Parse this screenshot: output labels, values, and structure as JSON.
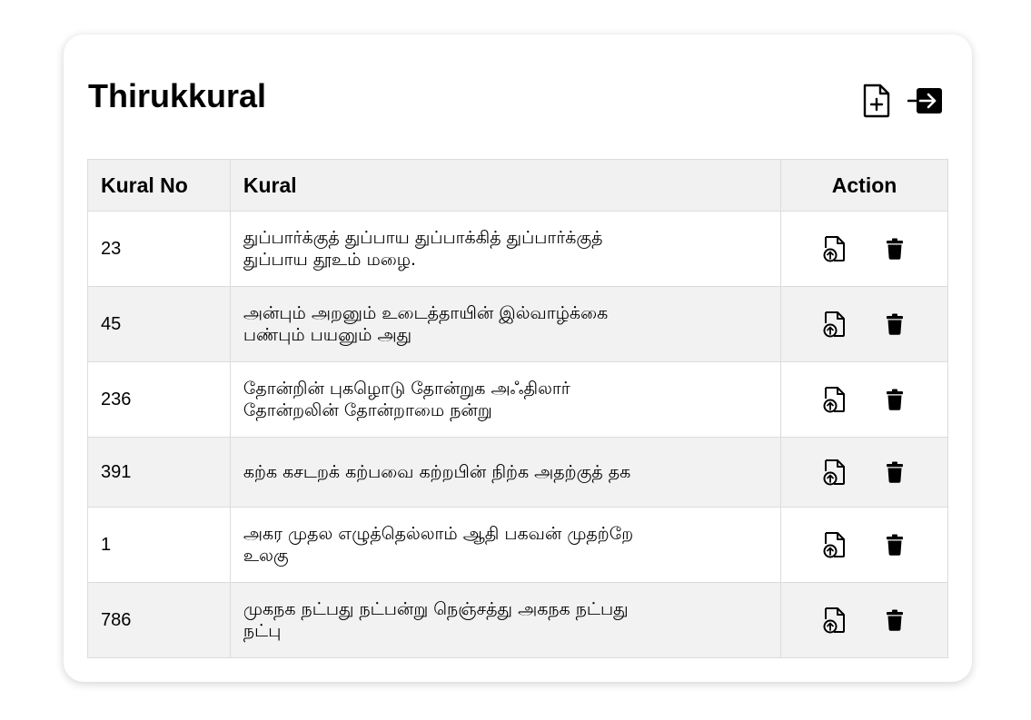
{
  "page": {
    "title": "Thirukkural"
  },
  "toolbar": {
    "add_icon": "file-add-icon",
    "logout_icon": "logout-icon"
  },
  "table": {
    "headers": {
      "no": "Kural No",
      "kural": "Kural",
      "action": "Action"
    },
    "rows": [
      {
        "no": "23",
        "kural_line1": "துப்பார்க்குத் துப்பாய துப்பாக்கித் துப்பார்க்குத்",
        "kural_line2": "துப்பாய தூஉம் மழை."
      },
      {
        "no": "45",
        "kural_line1": "அன்பும் அறனும் உடைத்தாயின் இல்வாழ்க்கை",
        "kural_line2": "பண்பும் பயனும் அது"
      },
      {
        "no": "236",
        "kural_line1": "தோன்றின் புகழொடு தோன்றுக அஃதிலார்",
        "kural_line2": "தோன்றலின் தோன்றாமை நன்று"
      },
      {
        "no": "391",
        "kural_line1": "கற்க கசடறக் கற்பவை கற்றபின் நிற்க அதற்குத் தக",
        "kural_line2": ""
      },
      {
        "no": "1",
        "kural_line1": "அகர முதல எழுத்தெல்லாம் ஆதி பகவன் முதற்றே",
        "kural_line2": "உலகு"
      },
      {
        "no": "786",
        "kural_line1": "முகநக நட்பது நட்பன்று நெஞ்சத்து அகநக நட்பது",
        "kural_line2": "நட்பு"
      }
    ]
  }
}
